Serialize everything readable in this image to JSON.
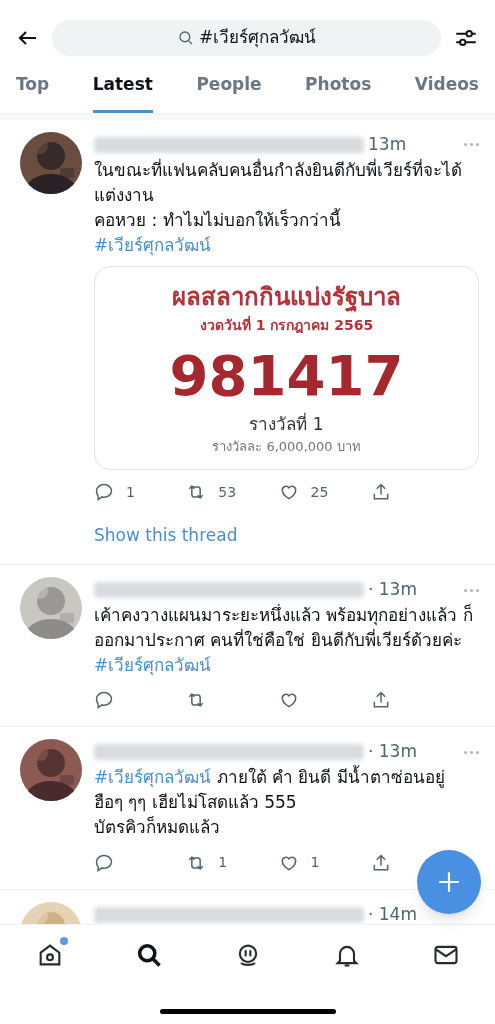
{
  "search": {
    "value": "#เวียร์ศุกลวัฒน์"
  },
  "tabs": [
    {
      "label": "Top",
      "selected": false
    },
    {
      "label": "Latest",
      "selected": true
    },
    {
      "label": "People",
      "selected": false
    },
    {
      "label": "Photos",
      "selected": false
    },
    {
      "label": "Videos",
      "selected": false
    }
  ],
  "tweets": [
    {
      "time": "13m",
      "body": [
        {
          "kind": "text",
          "text": "ในขณะที่แฟนคลับคนอื่นกำลังยินดีกับพี่เวียร์ที่จะได้แต่งงาน\nคอหวย : ทำไมไม่บอกให้เร็วกว่านี้\n"
        },
        {
          "kind": "hashtag",
          "text": "#เวียร์ศุกลวัฒน์"
        }
      ],
      "card": {
        "title": "ผลสลากกินแบ่งรัฐบาล",
        "date": "งวดวันที่ 1 กรกฎาคม 2565",
        "number": "981417",
        "prize": "รางวัลที่ 1",
        "amount": "รางวัลละ 6,000,000 บาท"
      },
      "actions": [
        {
          "kind": "reply",
          "count": "1"
        },
        {
          "kind": "retweet",
          "count": "53"
        },
        {
          "kind": "like",
          "count": "25"
        },
        {
          "kind": "share"
        }
      ],
      "thread_link": "Show this thread"
    },
    {
      "time": "· 13m",
      "body": [
        {
          "kind": "text",
          "text": "เค้าคงวางแผนมาระยะหนึ่งแล้ว พร้อมทุกอย่างแล้ว ก็ออกมาประกาศ คนที่ใช่คือใช่ ยินดีกับพี่เวียร์ด้วยค่ะ "
        },
        {
          "kind": "hashtag",
          "text": "#เวียร์ศุกลวัฒน์"
        }
      ],
      "actions": [
        {
          "kind": "reply"
        },
        {
          "kind": "retweet"
        },
        {
          "kind": "like"
        },
        {
          "kind": "share"
        }
      ]
    },
    {
      "time": "· 13m",
      "body": [
        {
          "kind": "hashtag",
          "text": "#เวียร์ศุกลวัฒน์"
        },
        {
          "kind": "text",
          "text": " ภายใต้ คำ ยินดี มีน้ำตาซ่อนอยู่\nฮือๆ ๆๆ เฮียไม่โสดแล้ว 555\nบัตรคิวก็หมดแล้ว"
        }
      ],
      "actions": [
        {
          "kind": "reply"
        },
        {
          "kind": "retweet",
          "count": "1"
        },
        {
          "kind": "like",
          "count": "1"
        },
        {
          "kind": "share"
        }
      ]
    },
    {
      "time": "· 14m"
    }
  ],
  "nav": [
    {
      "kind": "home",
      "badge": true,
      "selected": false
    },
    {
      "kind": "search",
      "badge": false,
      "selected": true
    },
    {
      "kind": "spaces",
      "badge": false,
      "selected": false
    },
    {
      "kind": "notifications",
      "badge": false,
      "selected": false
    },
    {
      "kind": "messages",
      "badge": false,
      "selected": false
    }
  ]
}
